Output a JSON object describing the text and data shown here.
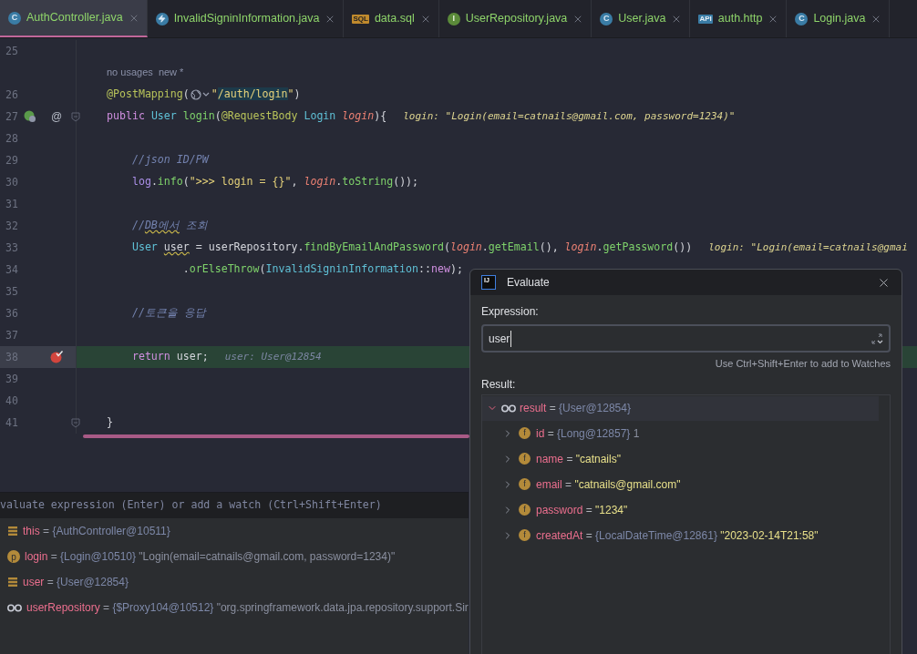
{
  "tabs": [
    {
      "label": "AuthController.java",
      "icon": {
        "kind": "class",
        "text": "C"
      },
      "selected": true
    },
    {
      "label": "InvalidSigninInformation.java",
      "icon": {
        "kind": "exception"
      },
      "selected": false
    },
    {
      "label": "data.sql",
      "icon": {
        "kind": "sql",
        "text": "SQL"
      },
      "selected": false
    },
    {
      "label": "UserRepository.java",
      "icon": {
        "kind": "interface",
        "text": "I"
      },
      "selected": false
    },
    {
      "label": "User.java",
      "icon": {
        "kind": "class",
        "text": "C"
      },
      "selected": false
    },
    {
      "label": "auth.http",
      "icon": {
        "kind": "http",
        "text": "API"
      },
      "selected": false
    },
    {
      "label": "Login.java",
      "icon": {
        "kind": "class",
        "text": "C"
      },
      "selected": false
    }
  ],
  "editor": {
    "lines": [
      {
        "number": "25",
        "current": false
      },
      {
        "current": false,
        "tokens": [
          {
            "kind": "inlay",
            "t": "no usages"
          },
          {
            "kind": "inlay",
            "t": "  new *"
          }
        ]
      },
      {
        "number": "26",
        "current": false,
        "tokens": [
          {
            "kind": "ann",
            "t": "@PostMapping"
          },
          {
            "kind": "plain",
            "t": "("
          },
          {
            "kind": "globe"
          },
          {
            "kind": "str",
            "t": "\""
          },
          {
            "kind": "strhl",
            "t": "/auth/login"
          },
          {
            "kind": "str",
            "t": "\""
          },
          {
            "kind": "plain",
            "t": ")"
          }
        ]
      },
      {
        "number": "27",
        "current": false,
        "gutter": [
          {
            "kind": "bean"
          },
          {
            "kind": "at",
            "text": "@"
          },
          {
            "kind": "fold"
          }
        ],
        "tokens": [
          {
            "kind": "kw",
            "t": "public "
          },
          {
            "kind": "type",
            "t": "User "
          },
          {
            "kind": "fn",
            "t": "login"
          },
          {
            "kind": "plain",
            "t": "("
          },
          {
            "kind": "ann",
            "t": "@RequestBody "
          },
          {
            "kind": "type",
            "t": "Login "
          },
          {
            "kind": "param",
            "t": "login"
          },
          {
            "kind": "plain",
            "t": "){"
          },
          {
            "kind": "hint",
            "t": "login: \"Login(email=catnails@gmail.com, password=1234)\""
          }
        ]
      },
      {
        "number": "28",
        "current": false
      },
      {
        "number": "29",
        "current": false,
        "tokens": [
          {
            "kind": "comment",
            "t": "    //json ID/PW"
          }
        ]
      },
      {
        "number": "30",
        "current": false,
        "tokens": [
          {
            "kind": "field",
            "t": "    log"
          },
          {
            "kind": "plain",
            "t": "."
          },
          {
            "kind": "fn",
            "t": "info"
          },
          {
            "kind": "plain",
            "t": "("
          },
          {
            "kind": "str",
            "t": "\">>> login = {}\""
          },
          {
            "kind": "plain",
            "t": ", "
          },
          {
            "kind": "param",
            "t": "login"
          },
          {
            "kind": "plain",
            "t": "."
          },
          {
            "kind": "fn",
            "t": "toString"
          },
          {
            "kind": "plain",
            "t": "());"
          }
        ]
      },
      {
        "number": "31",
        "current": false
      },
      {
        "number": "32",
        "current": false,
        "tokens": [
          {
            "kind": "comment",
            "t": "    //"
          },
          {
            "kind": "commentwavy",
            "t": "DB에서"
          },
          {
            "kind": "comment",
            "t": " 조회"
          }
        ]
      },
      {
        "number": "33",
        "current": false,
        "tokens": [
          {
            "kind": "type",
            "t": "    User "
          },
          {
            "kind": "wavy",
            "t": "user"
          },
          {
            "kind": "plain",
            "t": " = userRepository."
          },
          {
            "kind": "fn",
            "t": "findByEmailAndPassword"
          },
          {
            "kind": "plain",
            "t": "("
          },
          {
            "kind": "param",
            "t": "login"
          },
          {
            "kind": "plain",
            "t": "."
          },
          {
            "kind": "fn",
            "t": "getEmail"
          },
          {
            "kind": "plain",
            "t": "(), "
          },
          {
            "kind": "param",
            "t": "login"
          },
          {
            "kind": "plain",
            "t": "."
          },
          {
            "kind": "fn",
            "t": "getPassword"
          },
          {
            "kind": "plain",
            "t": "())"
          },
          {
            "kind": "hint",
            "t": "login: \"Login(email=catnails@gmai"
          }
        ]
      },
      {
        "number": "34",
        "current": false,
        "tokens": [
          {
            "kind": "plain",
            "t": "            ."
          },
          {
            "kind": "fn",
            "t": "orElseThrow"
          },
          {
            "kind": "plain",
            "t": "("
          },
          {
            "kind": "type",
            "t": "InvalidSigninInformation"
          },
          {
            "kind": "plain",
            "t": "::"
          },
          {
            "kind": "kw",
            "t": "new"
          },
          {
            "kind": "plain",
            "t": ");"
          }
        ]
      },
      {
        "number": "35",
        "current": false
      },
      {
        "number": "36",
        "current": false,
        "tokens": [
          {
            "kind": "comment",
            "t": "    //토큰을 응답"
          }
        ]
      },
      {
        "number": "37",
        "current": false
      },
      {
        "number": "38",
        "current": true,
        "gutter": [
          {
            "kind": "breakpoint"
          }
        ],
        "tokens": [
          {
            "kind": "kw",
            "t": "    return "
          },
          {
            "kind": "plain",
            "t": "user;"
          },
          {
            "kind": "hintgray",
            "t": "user: User@12854"
          }
        ]
      },
      {
        "number": "39",
        "current": false
      },
      {
        "number": "40",
        "current": false
      },
      {
        "number": "41",
        "current": false,
        "gutter": [
          {
            "kind": "fold"
          }
        ],
        "tokens": [
          {
            "kind": "plain",
            "t": "}"
          }
        ]
      }
    ]
  },
  "variables": {
    "prompt": "valuate expression (Enter) or add a watch (Ctrl+Shift+Enter)",
    "items": [
      {
        "icon": {
          "kind": "stack"
        },
        "name": "this",
        "operator": "=",
        "type": "{AuthController@10511}"
      },
      {
        "icon": {
          "kind": "param",
          "text": "p"
        },
        "name": "login",
        "operator": "=",
        "type": "{Login@10510}",
        "value": "\"Login(email=catnails@gmail.com, password=1234)\""
      },
      {
        "icon": {
          "kind": "stack"
        },
        "name": "user",
        "operator": "=",
        "type": "{User@12854}"
      },
      {
        "icon": {
          "kind": "watch"
        },
        "name": "userRepository",
        "operator": "=",
        "type": "{$Proxy104@10512}",
        "value": "\"org.springframework.data.jpa.repository.support.Sir"
      }
    ]
  },
  "dialog": {
    "icon_text": "IJ",
    "title": "Evaluate",
    "expression_label": "Expression:",
    "expression": "user",
    "hint": "Use Ctrl+Shift+Enter to add to Watches",
    "result_label": "Result:",
    "result": {
      "name": "result",
      "operator": "=",
      "type": "{User@12854}",
      "expanded": true,
      "children": [
        {
          "icon": "f",
          "name": "id",
          "operator": "=",
          "type": "{Long@12857}",
          "value": "1",
          "kind": "plain",
          "expanded": false
        },
        {
          "icon": "f",
          "name": "name",
          "operator": "=",
          "value": "\"catnails\"",
          "kind": "string",
          "expanded": false
        },
        {
          "icon": "f",
          "name": "email",
          "operator": "=",
          "value": "\"catnails@gmail.com\"",
          "kind": "string",
          "expanded": false
        },
        {
          "icon": "f",
          "name": "password",
          "operator": "=",
          "value": "\"1234\"",
          "kind": "string",
          "expanded": false
        },
        {
          "icon": "f",
          "name": "createdAt",
          "operator": "=",
          "type": "{LocalDateTime@12861}",
          "value": "\"2023-02-14T21:58\"",
          "kind": "string",
          "expanded": false
        }
      ]
    }
  }
}
